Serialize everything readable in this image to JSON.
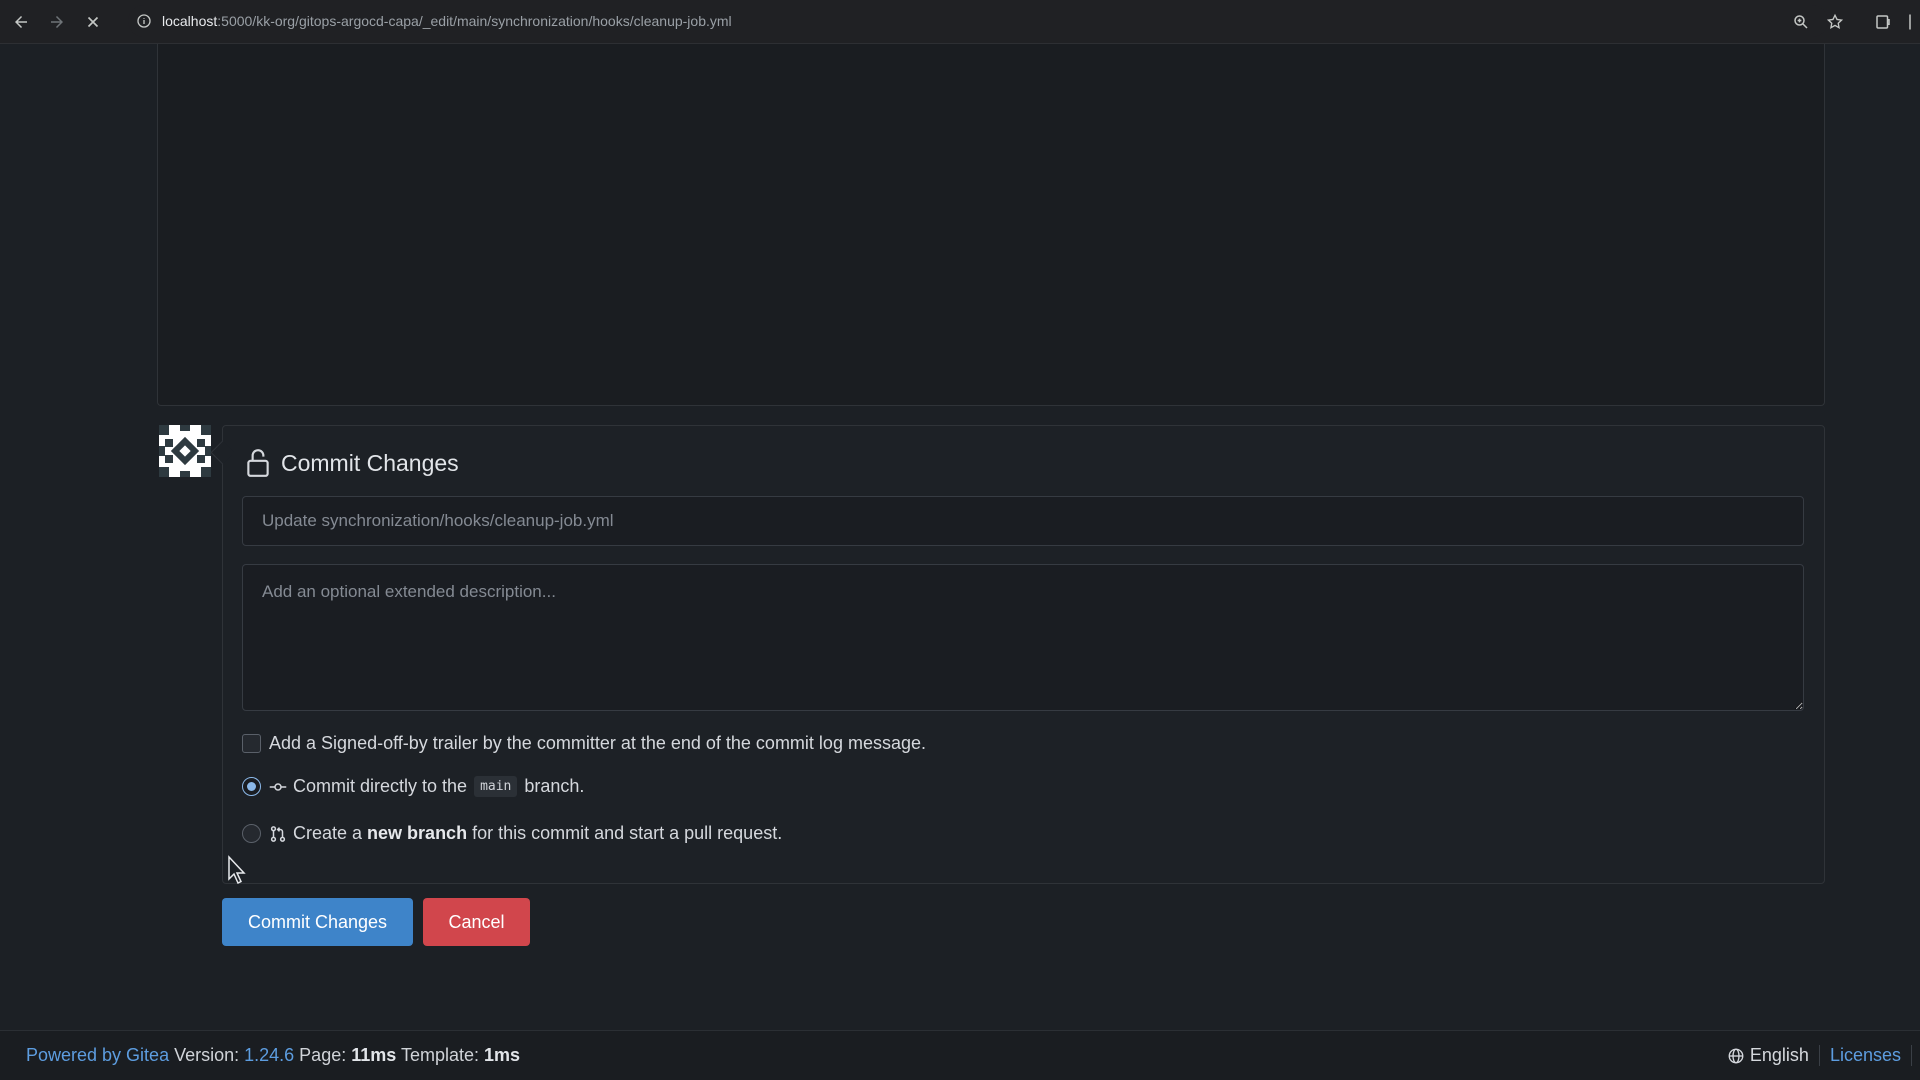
{
  "browser": {
    "url_host": "localhost",
    "url_rest": ":5000/kk-org/gitops-argocd-capa/_edit/main/synchronization/hooks/cleanup-job.yml"
  },
  "commit": {
    "title": "Commit Changes",
    "summary_placeholder": "Update synchronization/hooks/cleanup-job.yml",
    "description_placeholder": "Add an optional extended description...",
    "signoff_label": "Add a Signed-off-by trailer by the committer at the end of the commit log message.",
    "direct_prefix": "Commit directly to the",
    "branch_name": "main",
    "direct_suffix": "branch.",
    "new_branch_prefix": "Create a",
    "new_branch_bold": "new branch",
    "new_branch_suffix": "for this commit and start a pull request.",
    "selected_option": "direct"
  },
  "buttons": {
    "commit_label": "Commit Changes",
    "cancel_label": "Cancel"
  },
  "footer": {
    "powered": "Powered by Gitea",
    "version_label": " Version: ",
    "version": "1.24.6",
    "page_label": " Page: ",
    "page_time": "11ms",
    "template_label": " Template: ",
    "template_time": "1ms",
    "language": "English",
    "licenses": "Licenses"
  },
  "colors": {
    "primary": "#3e84c9",
    "danger": "#d1464c",
    "link": "#5d9de0",
    "background": "#1c2025"
  }
}
